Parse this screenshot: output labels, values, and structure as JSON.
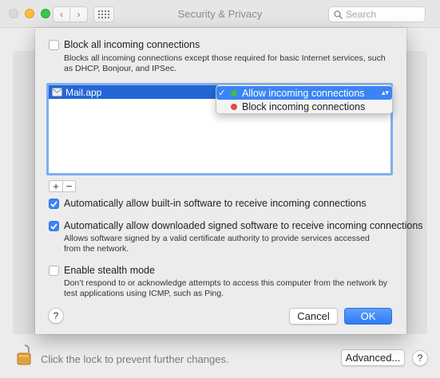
{
  "window": {
    "title": "Security & Privacy",
    "search_placeholder": "Search"
  },
  "sheet": {
    "block_all": {
      "label": "Block all incoming connections",
      "checked": false,
      "description": "Blocks all incoming connections except those required for basic Internet services, such as DHCP, Bonjour, and IPSec."
    },
    "apps": [
      {
        "name": "Mail.app",
        "setting": "Allow incoming connections"
      }
    ],
    "popup_options": [
      {
        "label": "Allow incoming connections",
        "color": "#3bbf44",
        "checked": true
      },
      {
        "label": "Block incoming connections",
        "color": "#e04b47",
        "checked": false
      }
    ],
    "add_symbol": "+",
    "remove_symbol": "−",
    "auto_builtin": {
      "label": "Automatically allow built-in software to receive incoming connections",
      "checked": true
    },
    "auto_signed": {
      "label": "Automatically allow downloaded signed software to receive incoming connections",
      "checked": true,
      "description": "Allows software signed by a valid certificate authority to provide services accessed from the network."
    },
    "stealth": {
      "label": "Enable stealth mode",
      "checked": false,
      "description": "Don’t respond to or acknowledge attempts to access this computer from the network by test applications using ICMP, such as Ping."
    },
    "help_symbol": "?",
    "cancel_label": "Cancel",
    "ok_label": "OK"
  },
  "footer": {
    "lock_message": "Click the lock to prevent further changes.",
    "advanced_label": "Advanced...",
    "help_symbol": "?"
  },
  "colors": {
    "accent": "#3b86f7",
    "selection": "#2566d6"
  }
}
